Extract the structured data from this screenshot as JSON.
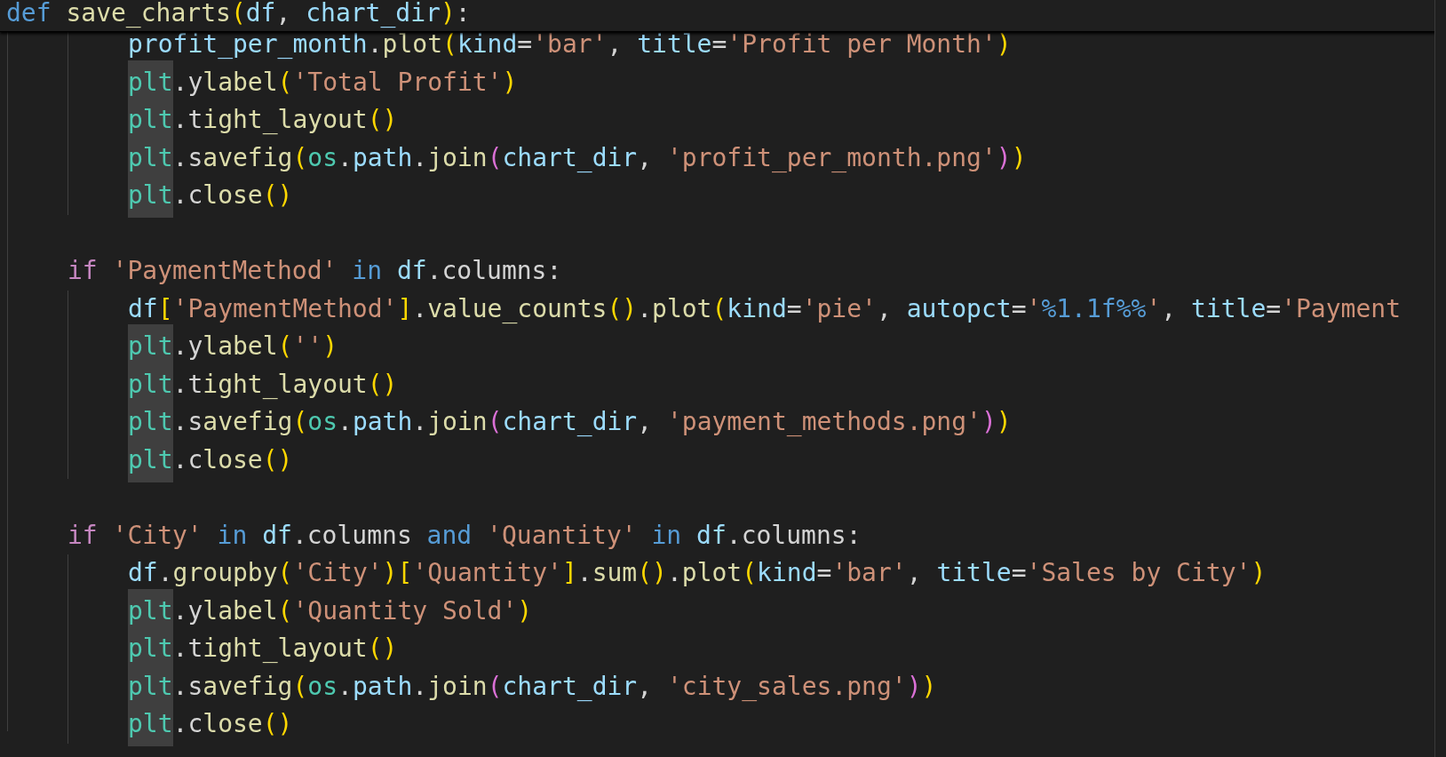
{
  "editor": {
    "sticky_header": {
      "tokens": [
        {
          "text": "def ",
          "kind": "kw"
        },
        {
          "text": "save_charts",
          "kind": "fn"
        },
        {
          "text": "(",
          "kind": "b1"
        },
        {
          "text": "df",
          "kind": "var"
        },
        {
          "text": ", ",
          "kind": "p"
        },
        {
          "text": "chart_dir",
          "kind": "var"
        },
        {
          "text": ")",
          "kind": "b1"
        },
        {
          "text": ":",
          "kind": "p"
        }
      ]
    },
    "blocks": [
      {
        "children": [
          {
            "tokens": [
              {
                "text": "profit_per_month",
                "kind": "var"
              },
              {
                "text": ".",
                "kind": "p"
              },
              {
                "text": "plot",
                "kind": "fn"
              },
              {
                "text": "(",
                "kind": "b1"
              },
              {
                "text": "kind",
                "kind": "var"
              },
              {
                "text": "=",
                "kind": "p"
              },
              {
                "text": "'bar'",
                "kind": "str"
              },
              {
                "text": ", ",
                "kind": "p"
              },
              {
                "text": "title",
                "kind": "var"
              },
              {
                "text": "=",
                "kind": "p"
              },
              {
                "text": "'Profit per Month'",
                "kind": "str"
              },
              {
                "text": ")",
                "kind": "b1"
              }
            ]
          },
          {
            "tokens": [
              {
                "text": "plt",
                "kind": "modhl"
              },
              {
                "text": ".ylabel",
                "kind": "dfn"
              },
              {
                "text": "(",
                "kind": "b1"
              },
              {
                "text": "'Total Profit'",
                "kind": "str"
              },
              {
                "text": ")",
                "kind": "b1"
              }
            ]
          },
          {
            "tokens": [
              {
                "text": "plt",
                "kind": "modhl"
              },
              {
                "text": ".tight_layout",
                "kind": "dfn"
              },
              {
                "text": "()",
                "kind": "b1"
              }
            ]
          },
          {
            "tokens": [
              {
                "text": "plt",
                "kind": "modhl"
              },
              {
                "text": ".savefig",
                "kind": "dfn"
              },
              {
                "text": "(",
                "kind": "b1"
              },
              {
                "text": "os",
                "kind": "mod"
              },
              {
                "text": ".",
                "kind": "p"
              },
              {
                "text": "path",
                "kind": "var"
              },
              {
                "text": ".",
                "kind": "p"
              },
              {
                "text": "join",
                "kind": "fn"
              },
              {
                "text": "(",
                "kind": "b2"
              },
              {
                "text": "chart_dir",
                "kind": "var"
              },
              {
                "text": ", ",
                "kind": "p"
              },
              {
                "text": "'profit_per_month.png'",
                "kind": "str"
              },
              {
                "text": ")",
                "kind": "b2"
              },
              {
                "text": ")",
                "kind": "b1"
              }
            ]
          },
          {
            "tokens": [
              {
                "text": "plt",
                "kind": "modhl"
              },
              {
                "text": ".close",
                "kind": "dfn"
              },
              {
                "text": "()",
                "kind": "b1"
              }
            ]
          }
        ]
      },
      {
        "tokens": [
          {
            "text": "if ",
            "kind": "ctl"
          },
          {
            "text": "'PaymentMethod'",
            "kind": "str"
          },
          {
            "text": " in ",
            "kind": "kw"
          },
          {
            "text": "df",
            "kind": "var"
          },
          {
            "text": ".",
            "kind": "p"
          },
          {
            "text": "columns",
            "kind": "p"
          },
          {
            "text": ":",
            "kind": "p"
          }
        ],
        "children": [
          {
            "tokens": [
              {
                "text": "df",
                "kind": "var"
              },
              {
                "text": "[",
                "kind": "b1"
              },
              {
                "text": "'PaymentMethod'",
                "kind": "str"
              },
              {
                "text": "]",
                "kind": "b1"
              },
              {
                "text": ".",
                "kind": "p"
              },
              {
                "text": "value_counts",
                "kind": "fn"
              },
              {
                "text": "()",
                "kind": "b1"
              },
              {
                "text": ".",
                "kind": "p"
              },
              {
                "text": "plot",
                "kind": "fn"
              },
              {
                "text": "(",
                "kind": "b1"
              },
              {
                "text": "kind",
                "kind": "var"
              },
              {
                "text": "=",
                "kind": "p"
              },
              {
                "text": "'pie'",
                "kind": "str"
              },
              {
                "text": ", ",
                "kind": "p"
              },
              {
                "text": "autopct",
                "kind": "var"
              },
              {
                "text": "=",
                "kind": "p"
              },
              {
                "text": "'",
                "kind": "str"
              },
              {
                "text": "%1.1f%%",
                "kind": "fmt"
              },
              {
                "text": "'",
                "kind": "str"
              },
              {
                "text": ", ",
                "kind": "p"
              },
              {
                "text": "title",
                "kind": "var"
              },
              {
                "text": "=",
                "kind": "p"
              },
              {
                "text": "'Payment",
                "kind": "str"
              }
            ]
          },
          {
            "tokens": [
              {
                "text": "plt",
                "kind": "modhl"
              },
              {
                "text": ".ylabel",
                "kind": "dfn"
              },
              {
                "text": "(",
                "kind": "b1"
              },
              {
                "text": "''",
                "kind": "str"
              },
              {
                "text": ")",
                "kind": "b1"
              }
            ]
          },
          {
            "tokens": [
              {
                "text": "plt",
                "kind": "modhl"
              },
              {
                "text": ".tight_layout",
                "kind": "dfn"
              },
              {
                "text": "()",
                "kind": "b1"
              }
            ]
          },
          {
            "tokens": [
              {
                "text": "plt",
                "kind": "modhl"
              },
              {
                "text": ".savefig",
                "kind": "dfn"
              },
              {
                "text": "(",
                "kind": "b1"
              },
              {
                "text": "os",
                "kind": "mod"
              },
              {
                "text": ".",
                "kind": "p"
              },
              {
                "text": "path",
                "kind": "var"
              },
              {
                "text": ".",
                "kind": "p"
              },
              {
                "text": "join",
                "kind": "fn"
              },
              {
                "text": "(",
                "kind": "b2"
              },
              {
                "text": "chart_dir",
                "kind": "var"
              },
              {
                "text": ", ",
                "kind": "p"
              },
              {
                "text": "'payment_methods.png'",
                "kind": "str"
              },
              {
                "text": ")",
                "kind": "b2"
              },
              {
                "text": ")",
                "kind": "b1"
              }
            ]
          },
          {
            "tokens": [
              {
                "text": "plt",
                "kind": "modhl"
              },
              {
                "text": ".close",
                "kind": "dfn"
              },
              {
                "text": "()",
                "kind": "b1"
              }
            ]
          }
        ]
      },
      {
        "tokens": [
          {
            "text": "if ",
            "kind": "ctl"
          },
          {
            "text": "'City'",
            "kind": "str"
          },
          {
            "text": " in ",
            "kind": "kw"
          },
          {
            "text": "df",
            "kind": "var"
          },
          {
            "text": ".",
            "kind": "p"
          },
          {
            "text": "columns",
            "kind": "p"
          },
          {
            "text": " and ",
            "kind": "kw"
          },
          {
            "text": "'Quantity'",
            "kind": "str"
          },
          {
            "text": " in ",
            "kind": "kw"
          },
          {
            "text": "df",
            "kind": "var"
          },
          {
            "text": ".",
            "kind": "p"
          },
          {
            "text": "columns",
            "kind": "p"
          },
          {
            "text": ":",
            "kind": "p"
          }
        ],
        "children": [
          {
            "tokens": [
              {
                "text": "df",
                "kind": "var"
              },
              {
                "text": ".",
                "kind": "p"
              },
              {
                "text": "groupby",
                "kind": "fn"
              },
              {
                "text": "(",
                "kind": "b1"
              },
              {
                "text": "'City'",
                "kind": "str"
              },
              {
                "text": ")",
                "kind": "b1"
              },
              {
                "text": "[",
                "kind": "b1"
              },
              {
                "text": "'Quantity'",
                "kind": "str"
              },
              {
                "text": "]",
                "kind": "b1"
              },
              {
                "text": ".",
                "kind": "p"
              },
              {
                "text": "sum",
                "kind": "fn"
              },
              {
                "text": "()",
                "kind": "b1"
              },
              {
                "text": ".",
                "kind": "p"
              },
              {
                "text": "plot",
                "kind": "fn"
              },
              {
                "text": "(",
                "kind": "b1"
              },
              {
                "text": "kind",
                "kind": "var"
              },
              {
                "text": "=",
                "kind": "p"
              },
              {
                "text": "'bar'",
                "kind": "str"
              },
              {
                "text": ", ",
                "kind": "p"
              },
              {
                "text": "title",
                "kind": "var"
              },
              {
                "text": "=",
                "kind": "p"
              },
              {
                "text": "'Sales by City'",
                "kind": "str"
              },
              {
                "text": ")",
                "kind": "b1"
              }
            ]
          },
          {
            "tokens": [
              {
                "text": "plt",
                "kind": "modhl"
              },
              {
                "text": ".ylabel",
                "kind": "dfn"
              },
              {
                "text": "(",
                "kind": "b1"
              },
              {
                "text": "'Quantity Sold'",
                "kind": "str"
              },
              {
                "text": ")",
                "kind": "b1"
              }
            ]
          },
          {
            "tokens": [
              {
                "text": "plt",
                "kind": "modhl"
              },
              {
                "text": ".tight_layout",
                "kind": "dfn"
              },
              {
                "text": "()",
                "kind": "b1"
              }
            ]
          },
          {
            "tokens": [
              {
                "text": "plt",
                "kind": "modhl"
              },
              {
                "text": ".savefig",
                "kind": "dfn"
              },
              {
                "text": "(",
                "kind": "b1"
              },
              {
                "text": "os",
                "kind": "mod"
              },
              {
                "text": ".",
                "kind": "p"
              },
              {
                "text": "path",
                "kind": "var"
              },
              {
                "text": ".",
                "kind": "p"
              },
              {
                "text": "join",
                "kind": "fn"
              },
              {
                "text": "(",
                "kind": "b2"
              },
              {
                "text": "chart_dir",
                "kind": "var"
              },
              {
                "text": ", ",
                "kind": "p"
              },
              {
                "text": "'city_sales.png'",
                "kind": "str"
              },
              {
                "text": ")",
                "kind": "b2"
              },
              {
                "text": ")",
                "kind": "b1"
              }
            ]
          },
          {
            "tokens": [
              {
                "text": "plt",
                "kind": "modhl"
              },
              {
                "text": ".close",
                "kind": "dfn"
              },
              {
                "text": "()",
                "kind": "b1"
              }
            ]
          }
        ]
      }
    ]
  }
}
